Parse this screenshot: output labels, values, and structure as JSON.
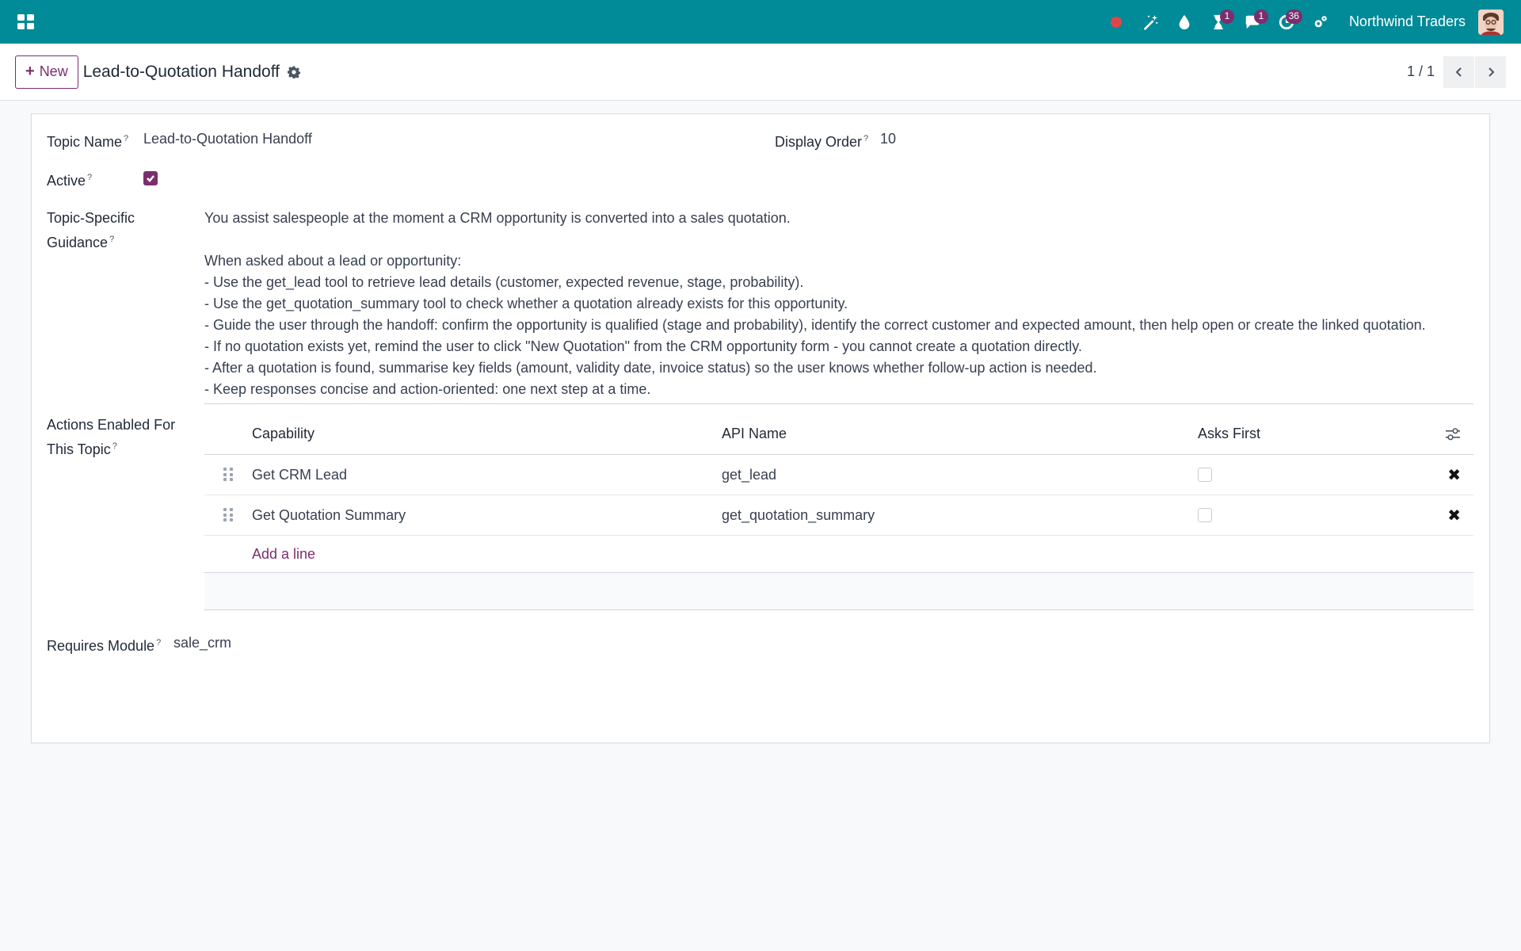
{
  "navbar": {
    "company": "Northwind Traders",
    "badges": {
      "activity": "1",
      "messages": "1",
      "timer": "36"
    },
    "icons": [
      "apps-icon",
      "record-dot-icon",
      "magic-wand-icon",
      "droplet-icon",
      "hourglass-icon",
      "chat-icon",
      "clock-icon",
      "settings-icon"
    ]
  },
  "control_panel": {
    "new_label": "New",
    "title": "Lead-to-Quotation Handoff",
    "pager": "1 / 1"
  },
  "form": {
    "topic_name_label": "Topic Name",
    "topic_name_value": "Lead-to-Quotation Handoff",
    "display_order_label": "Display Order",
    "display_order_value": "10",
    "active_label": "Active",
    "active_value": true,
    "guidance_label_1": "Topic-Specific",
    "guidance_label_2": "Guidance",
    "guidance_text": "You assist salespeople at the moment a CRM opportunity is converted into a sales quotation.\n\nWhen asked about a lead or opportunity:\n- Use the get_lead tool to retrieve lead details (customer, expected revenue, stage, probability).\n- Use the get_quotation_summary tool to check whether a quotation already exists for this opportunity.\n- Guide the user through the handoff: confirm the opportunity is qualified (stage and probability), identify the correct customer and expected amount, then help open or create the linked quotation.\n- If no quotation exists yet, remind the user to click \"New Quotation\" from the CRM opportunity form - you cannot create a quotation directly.\n- After a quotation is found, summarise key fields (amount, validity date, invoice status) so the user knows whether follow-up action is needed.\n- Keep responses concise and action-oriented: one next step at a time.",
    "actions_label_1": "Actions Enabled For",
    "actions_label_2": "This Topic",
    "requires_module_label": "Requires Module",
    "requires_module_value": "sale_crm",
    "help_mark": "?"
  },
  "actions_table": {
    "headers": {
      "capability": "Capability",
      "api_name": "API Name",
      "asks_first": "Asks First"
    },
    "rows": [
      {
        "capability": "Get CRM Lead",
        "api_name": "get_lead",
        "asks_first": false
      },
      {
        "capability": "Get Quotation Summary",
        "api_name": "get_quotation_summary",
        "asks_first": false
      }
    ],
    "add_line": "Add a line"
  },
  "colors": {
    "navbar": "#018a97",
    "accent": "#7b2e6e",
    "badge": "#7b2e6e"
  }
}
